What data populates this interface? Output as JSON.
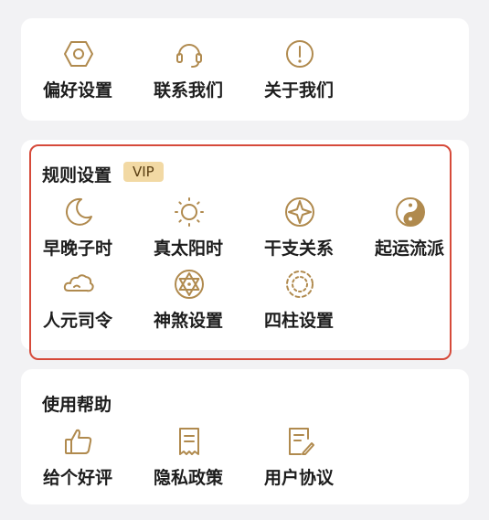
{
  "colors": {
    "accent": "#b08a4e",
    "highlight": "#d64a3a",
    "vip_bg": "#f2d9a4"
  },
  "general": {
    "items": [
      {
        "label": "偏好设置",
        "icon": "gear-hexagon-icon"
      },
      {
        "label": "联系我们",
        "icon": "headset-icon"
      },
      {
        "label": "关于我们",
        "icon": "info-circle-icon"
      }
    ]
  },
  "rules": {
    "title": "规则设置",
    "badge": "VIP",
    "items": [
      {
        "label": "早晚子时",
        "icon": "crescent-moon-icon"
      },
      {
        "label": "真太阳时",
        "icon": "sun-icon"
      },
      {
        "label": "干支关系",
        "icon": "compass-star-icon"
      },
      {
        "label": "起运流派",
        "icon": "yin-yang-icon"
      },
      {
        "label": "人元司令",
        "icon": "cloud-icon"
      },
      {
        "label": "神煞设置",
        "icon": "hexagram-icon"
      },
      {
        "label": "四柱设置",
        "icon": "dashed-circle-icon"
      }
    ]
  },
  "help": {
    "title": "使用帮助",
    "items": [
      {
        "label": "给个好评",
        "icon": "thumbs-up-icon"
      },
      {
        "label": "隐私政策",
        "icon": "receipt-icon"
      },
      {
        "label": "用户协议",
        "icon": "document-edit-icon"
      }
    ]
  }
}
